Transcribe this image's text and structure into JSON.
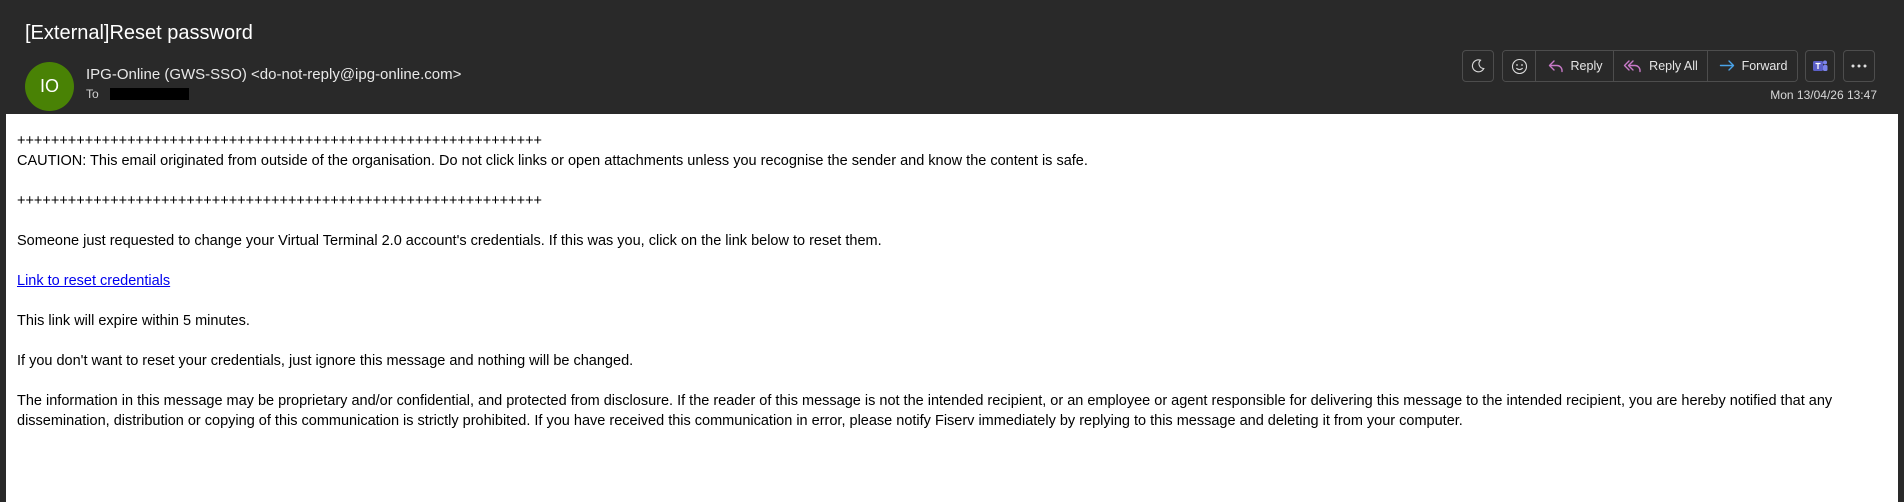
{
  "header": {
    "subject": "[External]Reset password",
    "avatar_initials": "IO",
    "avatar_color": "#498205",
    "sender": "IPG-Online (GWS-SSO) <do-not-reply@ipg-online.com>",
    "to_label": "To",
    "date": "Mon 13/04/26 13:47"
  },
  "toolbar": {
    "moon_icon": "moon-icon",
    "emoji_icon": "emoji-icon",
    "reply_label": "Reply",
    "reply_all_label": "Reply All",
    "forward_label": "Forward",
    "teams_icon": "teams-icon",
    "more_icon": "more-icon"
  },
  "message": {
    "separator_1": "++++++++++++++++++++++++++++++++++++++++++++++++++++++++++++++",
    "caution": "CAUTION: This email originated from outside of the organisation. Do not click links or open attachments unless you recognise the sender and know the content is safe.",
    "separator_2": "++++++++++++++++++++++++++++++++++++++++++++++++++++++++++++++",
    "request_text": "Someone just requested to change your Virtual Terminal 2.0 account's credentials. If this was you, click on the link below to reset them.",
    "link_text": "Link to reset credentials",
    "expiry_text": "This link will expire within 5 minutes.",
    "ignore_text": "If you don't want to reset your credentials, just ignore this message and nothing will be changed.",
    "disclaimer": "The information in this message may be proprietary and/or confidential, and protected from disclosure. If the reader of this message is not the intended recipient, or an employee or agent responsible for delivering this message to the intended recipient, you are hereby notified that any dissemination, distribution or copying of this communication is strictly prohibited. If you have received this communication in error, please notify Fiserv immediately by replying to this message and deleting it from your computer."
  }
}
